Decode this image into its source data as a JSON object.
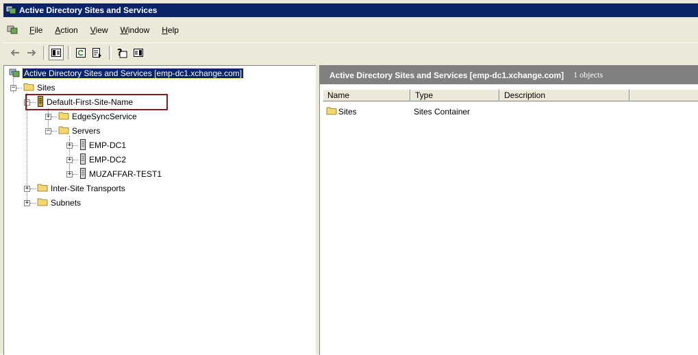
{
  "window": {
    "title": "Active Directory Sites and Services"
  },
  "menu": {
    "items": [
      {
        "label": "File",
        "u": "F",
        "rest": "ile"
      },
      {
        "label": "Action",
        "u": "A",
        "rest": "ction"
      },
      {
        "label": "View",
        "u": "V",
        "rest": "iew"
      },
      {
        "label": "Window",
        "u": "W",
        "rest": "indow"
      },
      {
        "label": "Help",
        "u": "H",
        "rest": "elp"
      }
    ]
  },
  "tree": {
    "root": "Active Directory Sites and Services [emp-dc1.xchange.com]",
    "sites": "Sites",
    "default_site": "Default-First-Site-Name",
    "edgesync": "EdgeSyncService",
    "servers": "Servers",
    "server1": "EMP-DC1",
    "server2": "EMP-DC2",
    "server3": "MUZAFFAR-TEST1",
    "intersite": "Inter-Site Transports",
    "subnets": "Subnets"
  },
  "right": {
    "header_title": "Active Directory Sites and Services [emp-dc1.xchange.com]",
    "count": "1 objects",
    "columns": [
      "Name",
      "Type",
      "Description"
    ],
    "rows": [
      {
        "name": "Sites",
        "type": "Sites Container",
        "description": ""
      }
    ]
  },
  "colors": {
    "titlebar": "#0a246a",
    "highlight": "#8b1a1a",
    "folder": "#f5d76e"
  }
}
